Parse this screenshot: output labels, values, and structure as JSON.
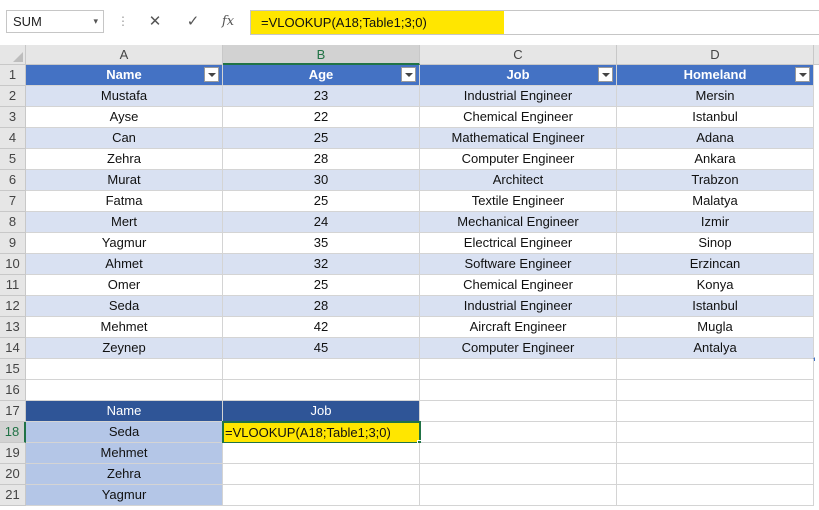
{
  "formula_bar": {
    "name_box": "SUM",
    "name_box_dropdown": "▾",
    "more": "⋮",
    "cancel_icon": "✕",
    "enter_icon": "✓",
    "fx_label": "fx",
    "formula": "=VLOOKUP(A18;Table1;3;0)"
  },
  "columns": [
    "A",
    "B",
    "C",
    "D"
  ],
  "rows": [
    "1",
    "2",
    "3",
    "4",
    "5",
    "6",
    "7",
    "8",
    "9",
    "10",
    "11",
    "12",
    "13",
    "14",
    "15",
    "16",
    "17",
    "18",
    "19",
    "20",
    "21"
  ],
  "table": {
    "headers": [
      "Name",
      "Age",
      "Job",
      "Homeland"
    ],
    "rows": [
      [
        "Mustafa",
        "23",
        "Industrial Engineer",
        "Mersin"
      ],
      [
        "Ayse",
        "22",
        "Chemical Engineer",
        "Istanbul"
      ],
      [
        "Can",
        "25",
        "Mathematical Engineer",
        "Adana"
      ],
      [
        "Zehra",
        "28",
        "Computer Engineer",
        "Ankara"
      ],
      [
        "Murat",
        "30",
        "Architect",
        "Trabzon"
      ],
      [
        "Fatma",
        "25",
        "Textile Engineer",
        "Malatya"
      ],
      [
        "Mert",
        "24",
        "Mechanical Engineer",
        "Izmir"
      ],
      [
        "Yagmur",
        "35",
        "Electrical Engineer",
        "Sinop"
      ],
      [
        "Ahmet",
        "32",
        "Software Engineer",
        "Erzincan"
      ],
      [
        "Omer",
        "25",
        "Chemical Engineer",
        "Konya"
      ],
      [
        "Seda",
        "28",
        "Industrial Engineer",
        "Istanbul"
      ],
      [
        "Mehmet",
        "42",
        "Aircraft Engineer",
        "Mugla"
      ],
      [
        "Zeynep",
        "45",
        "Computer Engineer",
        "Antalya"
      ]
    ]
  },
  "lookup": {
    "headers": [
      "Name",
      "Job"
    ],
    "names": [
      "Seda",
      "Mehmet",
      "Zehra",
      "Yagmur"
    ],
    "active_cell_text": "=VLOOKUP(A18;Table1;3;0)"
  },
  "colors": {
    "table_header": "#4472c4",
    "band": "#d9e1f2",
    "lookup_header": "#2f5597",
    "lookup_names": "#b4c6e7",
    "highlight": "#ffe600",
    "selection": "#217346"
  }
}
